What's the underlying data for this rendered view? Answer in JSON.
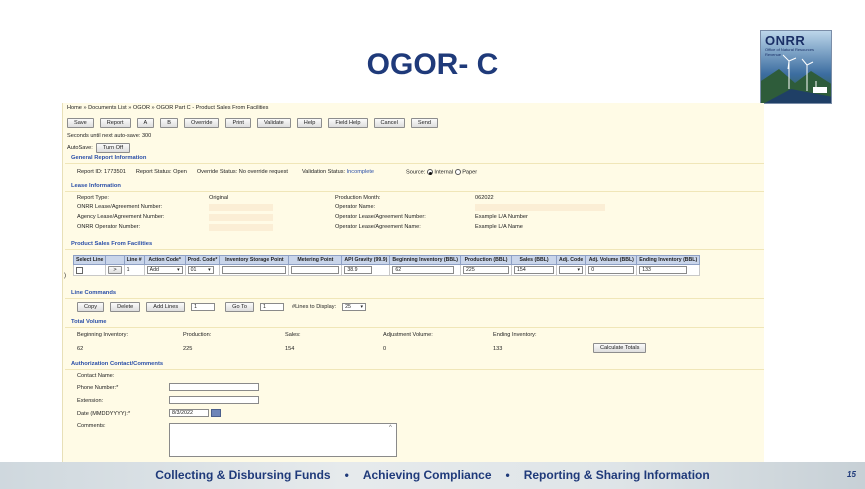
{
  "slide": {
    "title": "OGOR- C",
    "logo_text": "ONRR",
    "logo_sub": "Office of Natural Resources Revenue",
    "page_number": "15",
    "footer": [
      "Collecting & Disbursing Funds",
      "•",
      "Achieving Compliance",
      "•",
      "Reporting & Sharing Information"
    ]
  },
  "app": {
    "breadcrumb": "Home » Documents List » OGOR » OGOR Part C - Product Sales From Facilities",
    "toolbar": [
      "Save",
      "Report",
      "A",
      "B",
      "Override",
      "Print",
      "Validate",
      "Help",
      "Field Help",
      "Cancel",
      "Send"
    ],
    "autosave_text": "Seconds until next auto-save: 300",
    "autosave_label": "AutoSave:",
    "autosave_button": "Turn Off",
    "general": {
      "heading": "General Report Information",
      "report_id": "Report ID: 1773501",
      "report_status": "Report Status: Open",
      "override_status": "Override Status: No override request",
      "validation_label": "Validation Status:",
      "validation_value": "Incomplete",
      "source_label": "Source:",
      "source_internal": "Internal",
      "source_paper": "Paper"
    },
    "lease": {
      "heading": "Lease Information",
      "report_type_label": "Report Type:",
      "report_type_value": "Original",
      "onrr_lease_label": "ONRR Lease/Agreement Number:",
      "agency_lease_label": "Agency Lease/Agreement Number:",
      "operator_number_label": "ONRR Operator Number:",
      "production_month_label": "Production Month:",
      "production_month_value": "062022",
      "operator_name_label": "Operator Name:",
      "op_lease_number_label": "Operator Lease/Agreement Number:",
      "op_lease_number_value": "Example L/A Number",
      "op_lease_name_label": "Operator Lease/Agreement Name:",
      "op_lease_name_value": "Example L/A Name"
    },
    "sales": {
      "heading": "Product Sales From Facilities",
      "columns": [
        "Select Line",
        "",
        "Line #",
        "Action Code*",
        "Prod. Code*",
        "Inventory Storage Point",
        "Metering Point",
        "API Gravity (99.9)",
        "Beginning Inventory (BBL)",
        "Production (BBL)",
        "Sales (BBL)",
        "Adj. Code",
        "Adj. Volume (BBL)",
        "Ending Inventory (BBL)"
      ],
      "row": {
        "expand": ">",
        "line": "1",
        "action": "Add",
        "prod": "01",
        "storage": "",
        "metering": "",
        "api": "38.9",
        "beginning": "62",
        "production": "225",
        "sales": "154",
        "adj_code": "",
        "adj_volume": "0",
        "ending": "133"
      },
      "row_marker": ")"
    },
    "line_commands": {
      "heading": "Line Commands",
      "copy": "Copy",
      "delete": "Delete",
      "add_lines": "Add Lines",
      "add_count": "1",
      "go_to": "Go To",
      "go_to_value": "1",
      "lines_label": "#Lines to Display:",
      "lines_value": "25"
    },
    "totals": {
      "heading": "Total Volume",
      "labels": [
        "Beginning Inventory:",
        "Production:",
        "Sales:",
        "Adjustment Volume:",
        "Ending Inventory:"
      ],
      "values": [
        "62",
        "225",
        "154",
        "0",
        "133"
      ],
      "calculate": "Calculate Totals"
    },
    "contact": {
      "heading": "Authorization Contact/Comments",
      "name_label": "Contact Name:",
      "phone_label": "Phone Number:*",
      "extension_label": "Extension:",
      "date_label": "Date (MMDDYYYY):*",
      "date_value": "8/3/2022",
      "comments_label": "Comments:"
    }
  }
}
